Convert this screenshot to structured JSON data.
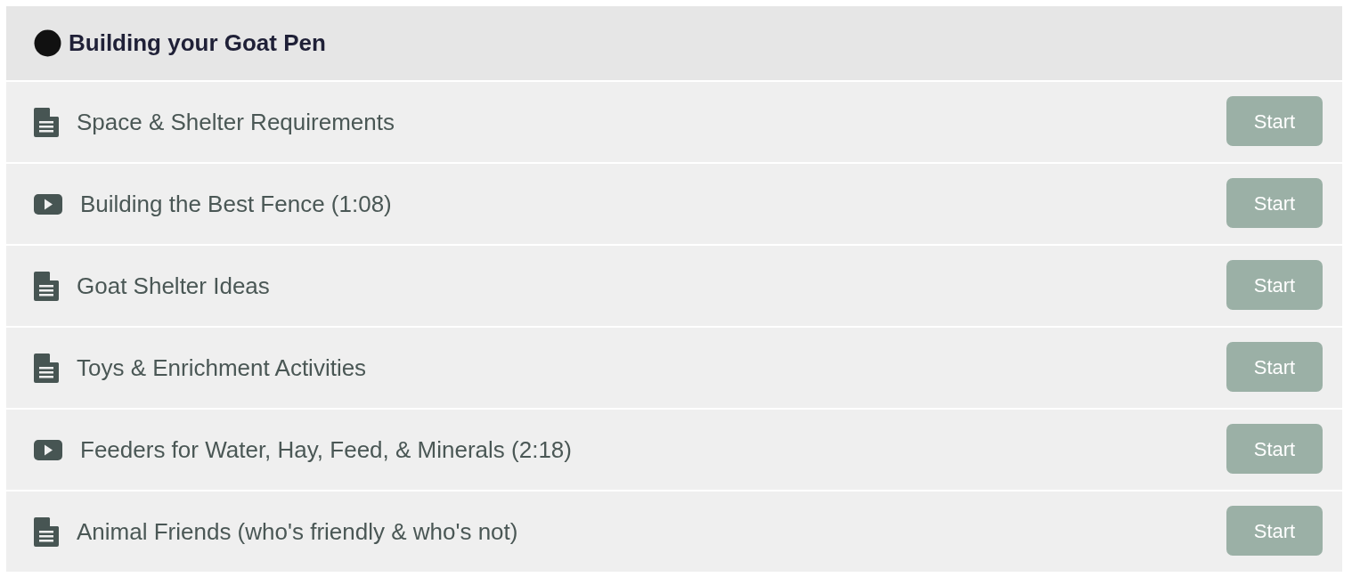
{
  "section": {
    "title": "Building your Goat Pen"
  },
  "lessons": [
    {
      "kind": "document",
      "title": "Space & Shelter Requirements",
      "button": "Start"
    },
    {
      "kind": "video",
      "title": "Building the Best Fence (1:08)",
      "button": "Start"
    },
    {
      "kind": "document",
      "title": "Goat Shelter Ideas",
      "button": "Start"
    },
    {
      "kind": "document",
      "title": "Toys & Enrichment Activities",
      "button": "Start"
    },
    {
      "kind": "video",
      "title": "Feeders for Water, Hay, Feed, & Minerals (2:18)",
      "button": "Start"
    },
    {
      "kind": "document",
      "title": "Animal Friends (who's friendly & who's not)",
      "button": "Start"
    }
  ]
}
